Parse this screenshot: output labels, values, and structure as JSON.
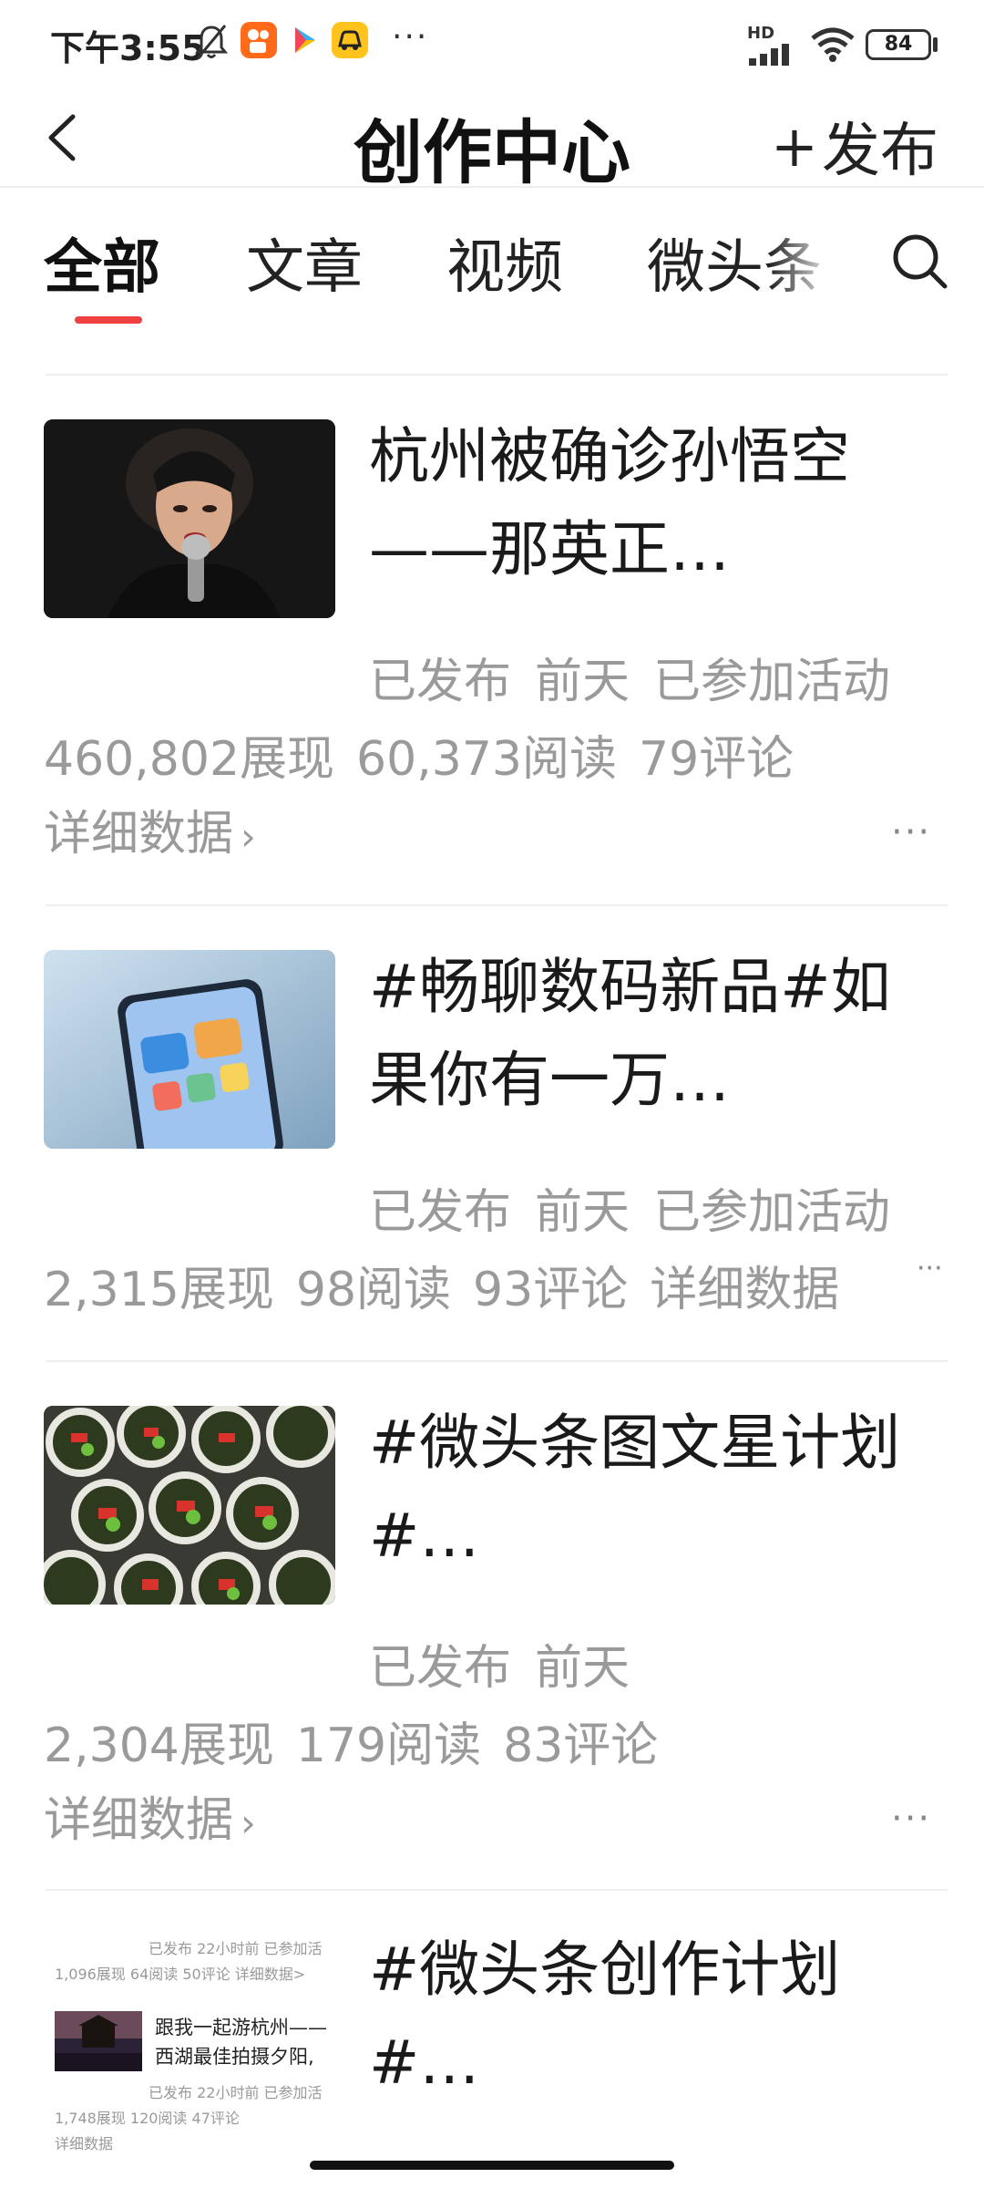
{
  "status_bar": {
    "time": "下午3:55",
    "network": "HD",
    "battery": "84",
    "more": "···",
    "icons": [
      "mute-bell-icon",
      "kuaishou-app-icon",
      "play-store-icon",
      "taxi-app-icon",
      "signal-icon",
      "wifi-icon",
      "battery-icon"
    ]
  },
  "header": {
    "back_icon": "chevron-left-icon",
    "title": "创作中心",
    "publish_plus": "+",
    "publish_label": "发布"
  },
  "tabs": [
    {
      "label": "全部",
      "active": true
    },
    {
      "label": "文章",
      "active": false
    },
    {
      "label": "视频",
      "active": false
    },
    {
      "label": "微头条",
      "active": false
    }
  ],
  "search_icon": "search-icon",
  "accent_color": "#f04142",
  "feed": [
    {
      "title": "杭州被确诊孙悟空——那英正…",
      "status": "已发布",
      "time": "前天",
      "activity": "已参加活动",
      "impressions": "460,802展现",
      "reads": "60,373阅读",
      "comments": "79评论",
      "details": "详细数据",
      "more": "···"
    },
    {
      "title": "#畅聊数码新品#如果你有一万…",
      "status": "已发布",
      "time": "前天",
      "activity": "已参加活动",
      "impressions": "2,315展现",
      "reads": "98阅读",
      "comments": "93评论",
      "details": "详细数据",
      "more": "···"
    },
    {
      "title": "#微头条图文星计划#…",
      "status": "已发布",
      "time": "前天",
      "impressions": "2,304展现",
      "reads": "179阅读",
      "comments": "83评论",
      "details": "详细数据",
      "more": "···"
    },
    {
      "title": "#微头条创作计划#…",
      "thumb_text": {
        "line1": "已发布  22小时前  已参加活",
        "line2": "1,096展现  64阅读  50评论  详细数据>",
        "headline": "跟我一起游杭州——西湖最佳拍摄夕阳,",
        "line3": "已发布  22小时前  已参加活",
        "line4": "1,748展现  120阅读  47评论",
        "line5": "详细数据"
      }
    }
  ]
}
